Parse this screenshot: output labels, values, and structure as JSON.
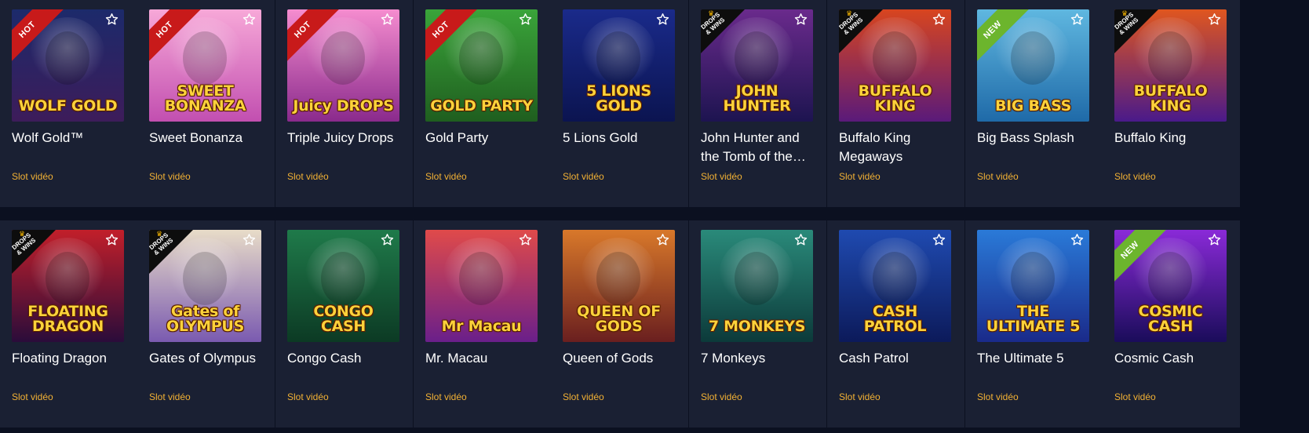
{
  "games": [
    {
      "title": "Wolf Gold™",
      "type": "Slot vidéo",
      "art_text": "WOLF GOLD",
      "badge": "HOT",
      "favorite_icon": "star-outline-icon",
      "colors": [
        "#1c2a6b",
        "#3d1c5a"
      ]
    },
    {
      "title": "Sweet Bonanza",
      "type": "Slot vidéo",
      "art_text": "SWEET BONANZA",
      "badge": "HOT",
      "favorite_icon": "star-outline-icon",
      "colors": [
        "#f7a8d8",
        "#c24fb0"
      ]
    },
    {
      "title": "Triple Juicy Drops",
      "type": "Slot vidéo",
      "art_text": "Juicy DROPS",
      "badge": "HOT",
      "favorite_icon": "star-outline-icon",
      "colors": [
        "#f58ccf",
        "#8a2a8c"
      ]
    },
    {
      "title": "Gold Party",
      "type": "Slot vidéo",
      "art_text": "GOLD PARTY",
      "badge": "HOT",
      "favorite_icon": "star-outline-icon",
      "colors": [
        "#3aa43a",
        "#1f5e1f"
      ]
    },
    {
      "title": "5 Lions Gold",
      "type": "Slot vidéo",
      "art_text": "5 LIONS GOLD",
      "badge": "",
      "favorite_icon": "star-outline-icon",
      "colors": [
        "#1a2a8a",
        "#0b1450"
      ]
    },
    {
      "title": "John Hunter and the Tomb of the…",
      "type": "Slot vidéo",
      "art_text": "JOHN HUNTER",
      "badge": "DROPS & WINS",
      "favorite_icon": "star-outline-icon",
      "colors": [
        "#6a2a8c",
        "#1d1450"
      ]
    },
    {
      "title": "Buffalo King Megaways",
      "type": "Slot vidéo",
      "art_text": "BUFFALO KING",
      "badge": "DROPS & WINS",
      "favorite_icon": "star-outline-icon",
      "colors": [
        "#d8451f",
        "#5a1a7a"
      ]
    },
    {
      "title": "Big Bass Splash",
      "type": "Slot vidéo",
      "art_text": "BIG BASS",
      "badge": "NEW",
      "favorite_icon": "star-outline-icon",
      "colors": [
        "#5fb7e0",
        "#1f6aa8"
      ]
    },
    {
      "title": "Buffalo King",
      "type": "Slot vidéo",
      "art_text": "BUFFALO KING",
      "badge": "DROPS & WINS",
      "favorite_icon": "star-outline-icon",
      "colors": [
        "#e0561f",
        "#4a1a8a"
      ]
    },
    {
      "title": "Floating Dragon",
      "type": "Slot vidéo",
      "art_text": "FLOATING DRAGON",
      "badge": "DROPS & WINS",
      "favorite_icon": "star-outline-icon",
      "colors": [
        "#c21f2a",
        "#2a0c3a"
      ]
    },
    {
      "title": "Gates of Olympus",
      "type": "Slot vidéo",
      "art_text": "Gates of OLYMPUS",
      "badge": "DROPS & WINS",
      "favorite_icon": "star-outline-icon",
      "colors": [
        "#e8dcc8",
        "#7a5ab0"
      ]
    },
    {
      "title": "Congo Cash",
      "type": "Slot vidéo",
      "art_text": "CONGO CASH",
      "badge": "",
      "favorite_icon": "star-outline-icon",
      "colors": [
        "#1f7a4a",
        "#0c3a24"
      ]
    },
    {
      "title": "Mr. Macau",
      "type": "Slot vidéo",
      "art_text": "Mr Macau",
      "badge": "",
      "favorite_icon": "star-outline-icon",
      "colors": [
        "#e04a4a",
        "#6a1f8a"
      ]
    },
    {
      "title": "Queen of Gods",
      "type": "Slot vidéo",
      "art_text": "QUEEN OF GODS",
      "badge": "",
      "favorite_icon": "star-outline-icon",
      "colors": [
        "#d8782a",
        "#6a1f1f"
      ]
    },
    {
      "title": "7 Monkeys",
      "type": "Slot vidéo",
      "art_text": "7 MONKEYS",
      "badge": "",
      "favorite_icon": "star-outline-icon",
      "colors": [
        "#2a8a7a",
        "#0c3a3a"
      ]
    },
    {
      "title": "Cash Patrol",
      "type": "Slot vidéo",
      "art_text": "CASH PATROL",
      "badge": "",
      "favorite_icon": "star-outline-icon",
      "colors": [
        "#1f4ab0",
        "#0c1a5a"
      ]
    },
    {
      "title": "The Ultimate 5",
      "type": "Slot vidéo",
      "art_text": "THE ULTIMATE 5",
      "badge": "",
      "favorite_icon": "star-outline-icon",
      "colors": [
        "#2a7ad8",
        "#1a2a8a"
      ]
    },
    {
      "title": "Cosmic Cash",
      "type": "Slot vidéo",
      "art_text": "COSMIC CASH",
      "badge": "NEW",
      "favorite_icon": "star-outline-icon",
      "colors": [
        "#8a2ad8",
        "#1a0c5a"
      ]
    }
  ]
}
